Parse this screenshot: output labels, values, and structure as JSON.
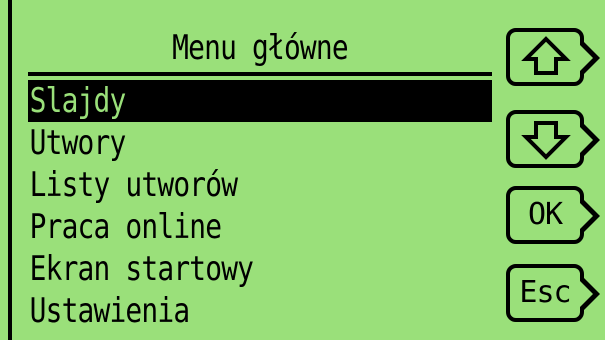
{
  "menu": {
    "title": "Menu główne",
    "items": [
      {
        "label": "Slajdy",
        "selected": true
      },
      {
        "label": "Utwory",
        "selected": false
      },
      {
        "label": "Listy utworów",
        "selected": false
      },
      {
        "label": "Praca online",
        "selected": false
      },
      {
        "label": "Ekran startowy",
        "selected": false
      },
      {
        "label": "Ustawienia",
        "selected": false
      }
    ]
  },
  "buttons": {
    "up_icon": "arrow-up-icon",
    "down_icon": "arrow-down-icon",
    "ok_label": "OK",
    "esc_label": "Esc"
  },
  "colors": {
    "lcd_background": "#9ae07a",
    "foreground": "#000000"
  }
}
